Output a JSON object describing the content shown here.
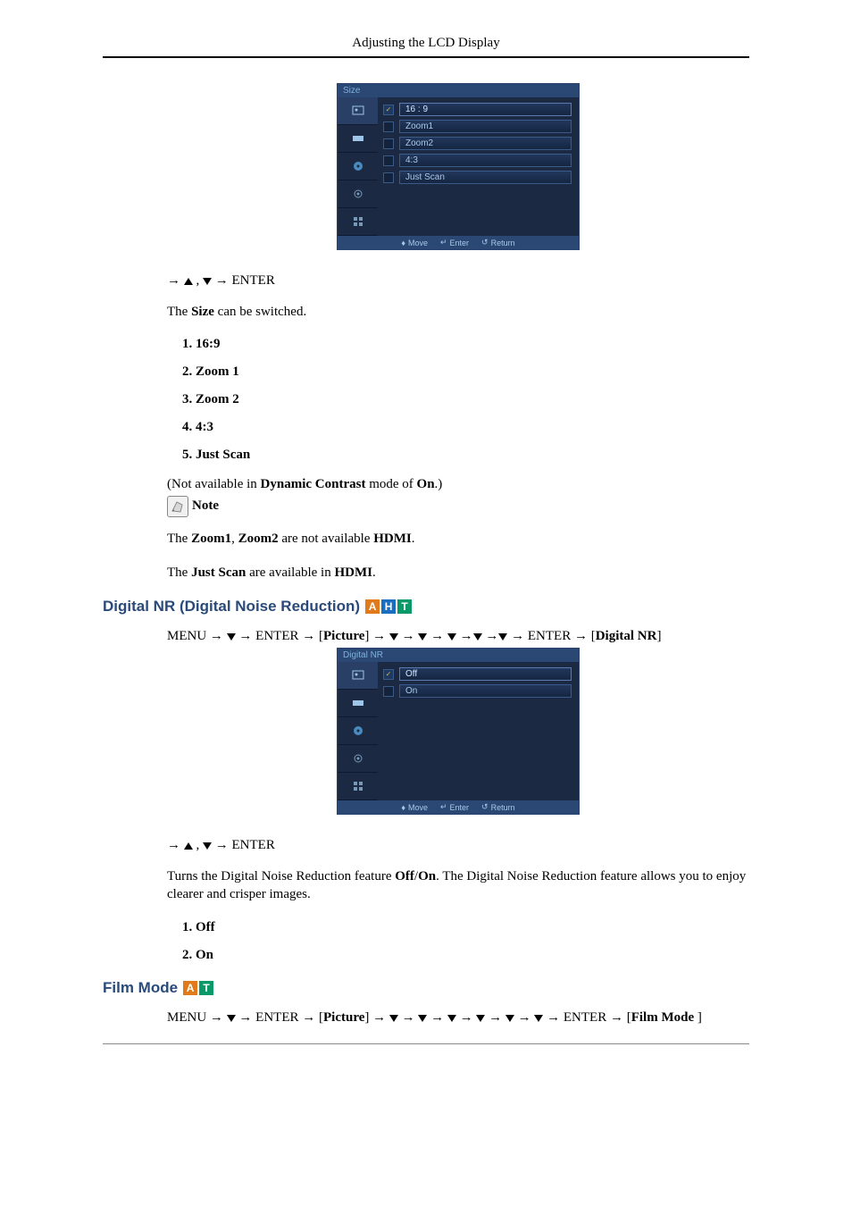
{
  "header": {
    "title": "Adjusting the LCD Display"
  },
  "osd_size": {
    "title": "Size",
    "rows": [
      {
        "label": "16 : 9",
        "selected": true
      },
      {
        "label": "Zoom1",
        "selected": false
      },
      {
        "label": "Zoom2",
        "selected": false
      },
      {
        "label": "4:3",
        "selected": false
      },
      {
        "label": "Just Scan",
        "selected": false
      }
    ],
    "footer": {
      "move": "Move",
      "enter": "Enter",
      "return": "Return"
    }
  },
  "nav_enter": "ENTER",
  "size_text": {
    "pre": "The ",
    "bold": "Size",
    "post": " can be switched."
  },
  "size_options": [
    "16:9",
    "Zoom 1",
    "Zoom 2",
    "4:3",
    "Just Scan"
  ],
  "dc_note": {
    "pre": "(Not available in ",
    "b1": "Dynamic Contrast",
    "mid": " mode of ",
    "b2": "On",
    "post": ".)"
  },
  "note_label": "Note",
  "zoom_note": {
    "pre": "The ",
    "b1": "Zoom1",
    "sep": ", ",
    "b2": "Zoom2",
    "mid": " are not available ",
    "b3": "HDMI",
    "post": "."
  },
  "justscan_note": {
    "pre": "The ",
    "b1": "Just Scan",
    "mid": " are available in ",
    "b2": "HDMI",
    "post": "."
  },
  "section_dnr": {
    "title": "Digital NR (Digital Noise Reduction)",
    "badges": [
      "A",
      "H",
      "T"
    ]
  },
  "path_dnr": {
    "menu": "MENU",
    "enter": "ENTER",
    "picture": "Picture",
    "target": "Digital NR"
  },
  "osd_dnr": {
    "title": "Digital NR",
    "rows": [
      {
        "label": "Off",
        "selected": true
      },
      {
        "label": "On",
        "selected": false
      }
    ],
    "footer": {
      "move": "Move",
      "enter": "Enter",
      "return": "Return"
    }
  },
  "dnr_desc": {
    "pre": "Turns the Digital Noise Reduction feature ",
    "b1": "Off",
    "slash": "/",
    "b2": "On",
    "post": ". The Digital Noise Reduction feature allows you to enjoy clearer and crisper images."
  },
  "dnr_options": [
    "Off",
    "On"
  ],
  "section_film": {
    "title": "Film Mode",
    "badges": [
      "A",
      "T"
    ]
  },
  "path_film": {
    "menu": "MENU",
    "enter": "ENTER",
    "picture": "Picture",
    "target": "Film Mode "
  }
}
